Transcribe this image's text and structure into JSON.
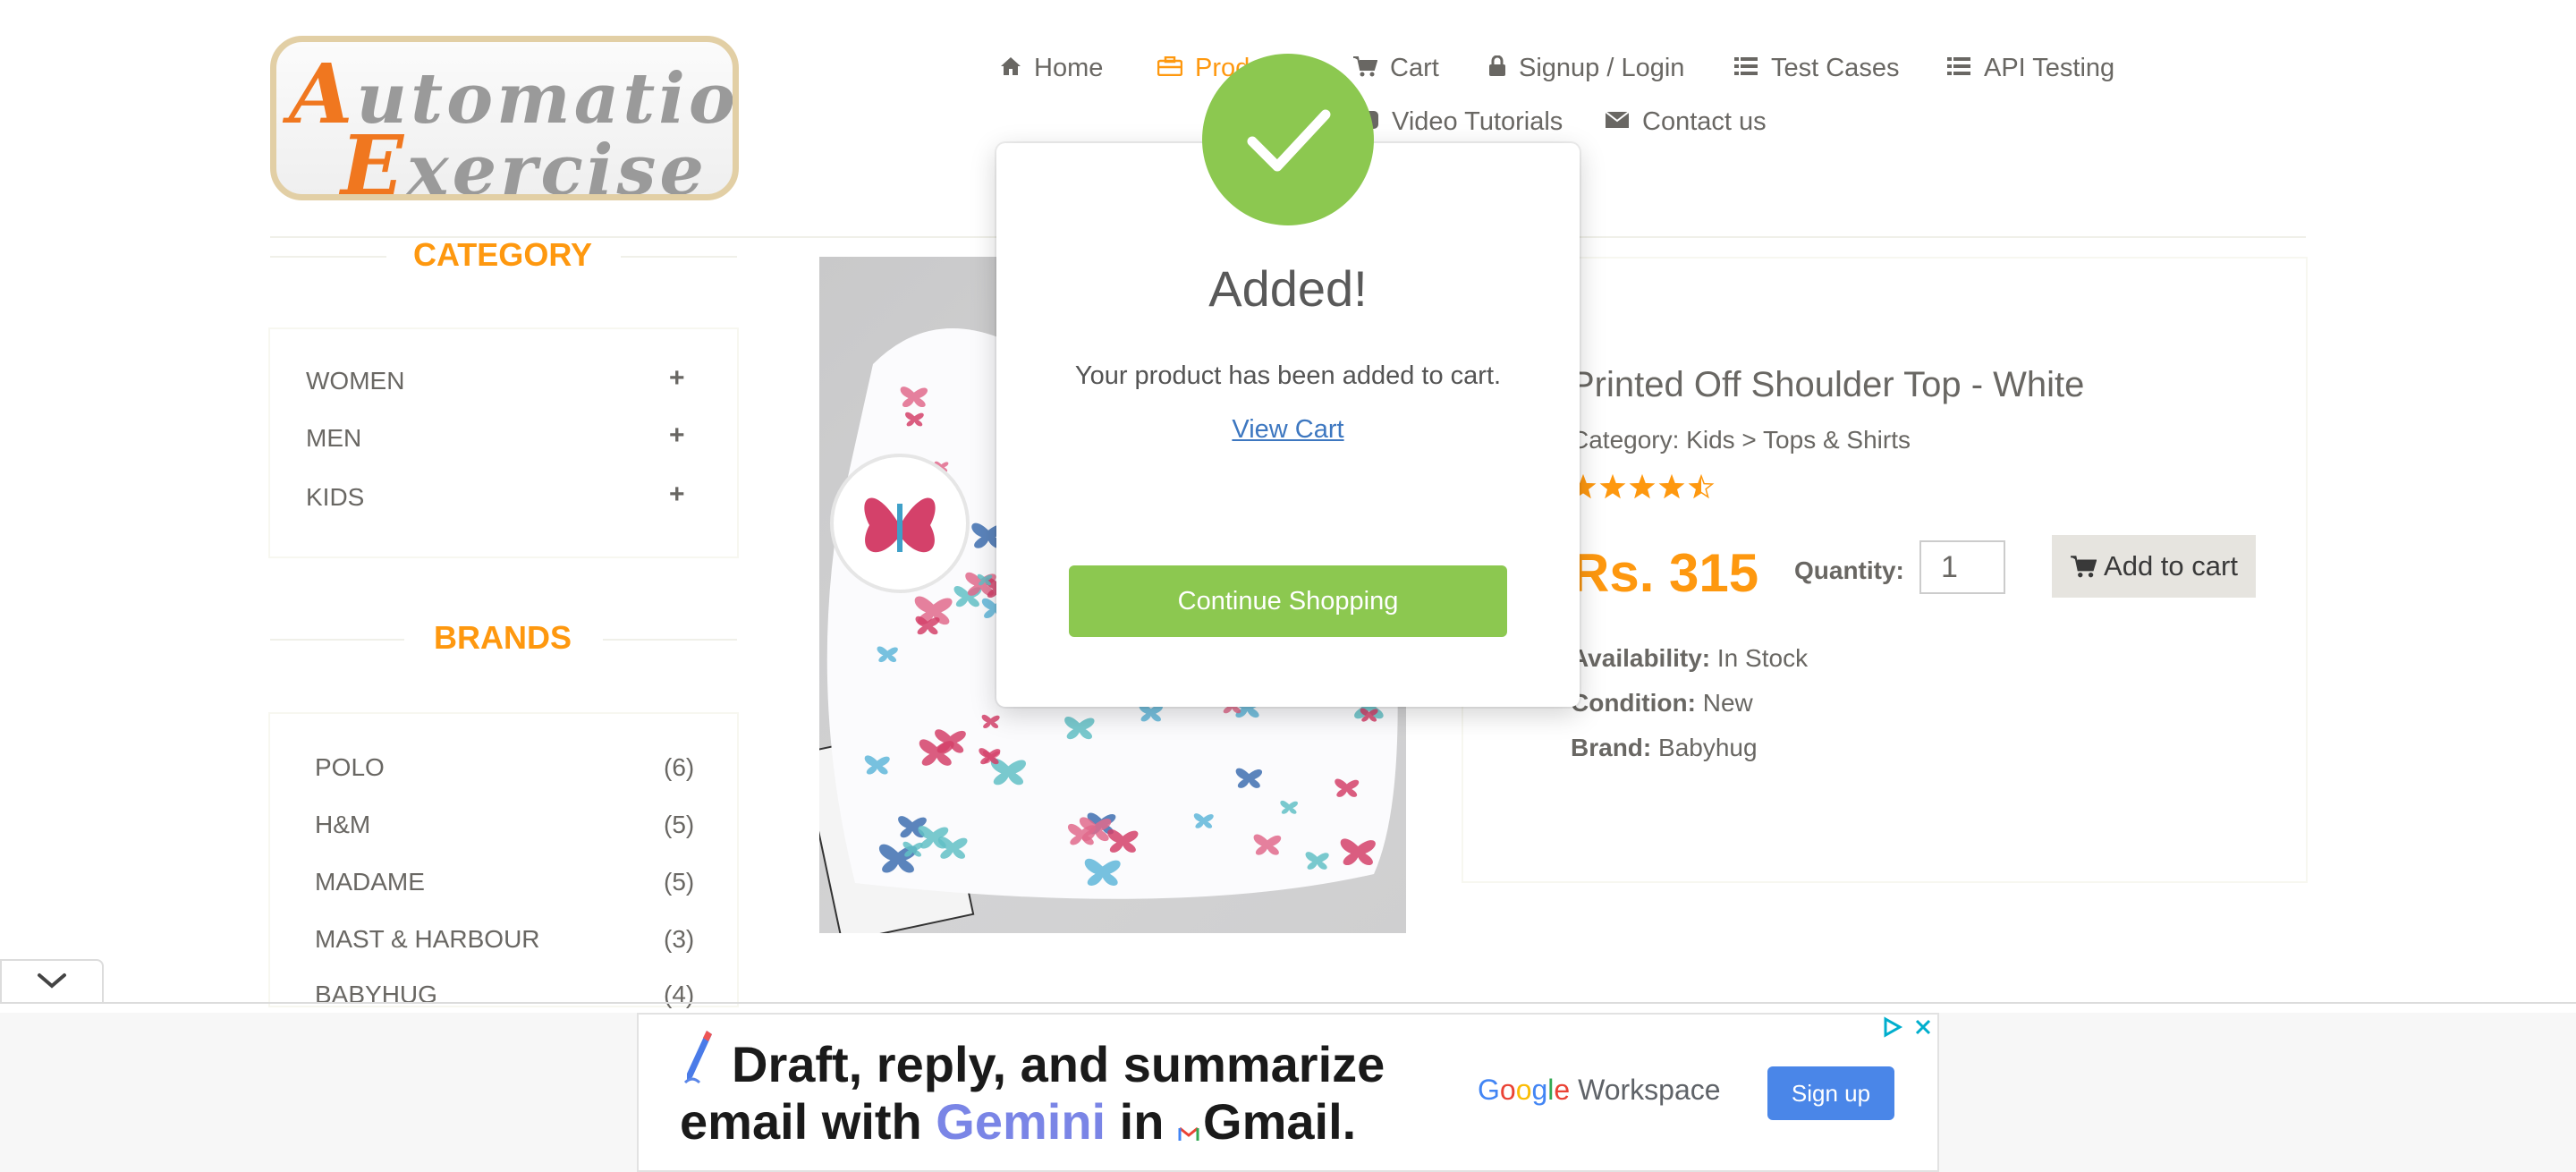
{
  "logo": {
    "line1": "Automation",
    "line2": "Exercise"
  },
  "nav": {
    "home": "Home",
    "products": "Products",
    "cart": "Cart",
    "signup_login": "Signup / Login",
    "test_cases": "Test Cases",
    "api_testing": "API Testing",
    "video_tutorials": "Video Tutorials",
    "contact_us": "Contact us"
  },
  "sidebar": {
    "category_title": "CATEGORY",
    "categories": [
      "WOMEN",
      "MEN",
      "KIDS"
    ],
    "brands_title": "BRANDS",
    "brands": [
      {
        "name": "POLO",
        "count": "(6)"
      },
      {
        "name": "H&M",
        "count": "(5)"
      },
      {
        "name": "MADAME",
        "count": "(5)"
      },
      {
        "name": "MAST & HARBOUR",
        "count": "(3)"
      },
      {
        "name": "BABYHUG",
        "count": "(4)"
      }
    ]
  },
  "product": {
    "title": "Printed Off Shoulder Top - White",
    "category": "Category: Kids > Tops & Shirts",
    "rating": 4.5,
    "price": "Rs. 315",
    "quantity_label": "Quantity:",
    "quantity_value": "1",
    "add_to_cart": "Add to cart",
    "availability_label": "Availability:",
    "availability": "In Stock",
    "condition_label": "Condition:",
    "condition": "New",
    "brand_label": "Brand:",
    "brand": "Babyhug"
  },
  "modal": {
    "title": "Added!",
    "message": "Your product has been added to cart.",
    "view_cart": "View Cart",
    "continue_button": "Continue Shopping"
  },
  "ad": {
    "line1": "Draft, reply, and summarize",
    "line2_prefix": "email with ",
    "line2_gemini": "Gemini",
    "line2_mid": " in ",
    "line2_gmail": "Gmail.",
    "brand_google": "Google",
    "brand_workspace": "Workspace",
    "signup": "Sign up"
  },
  "colors": {
    "accent": "#fe980f",
    "success": "#8cc850",
    "link": "#3d77c0",
    "text": "#696763"
  }
}
